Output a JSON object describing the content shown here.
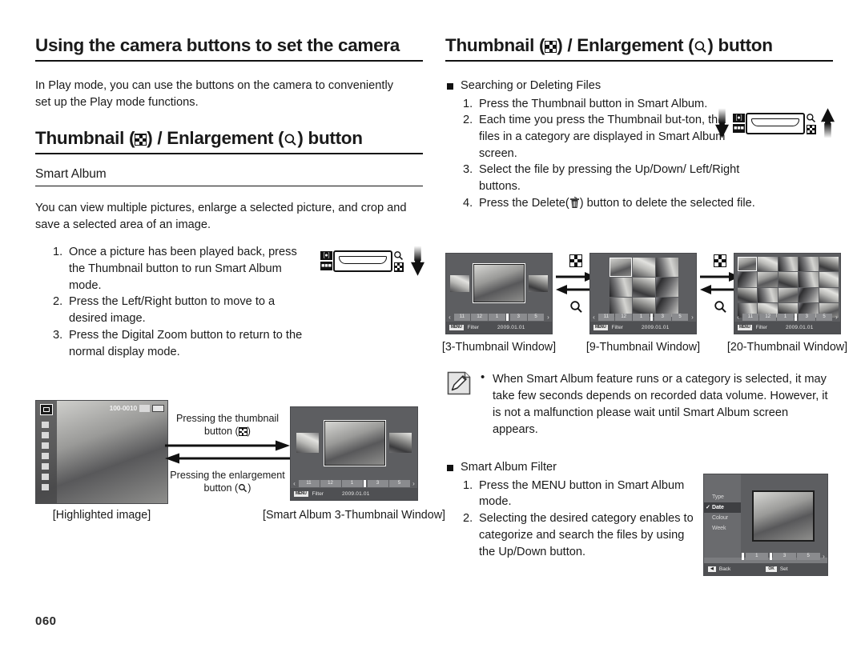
{
  "page": {
    "number": "060"
  },
  "left": {
    "title": "Using the camera buttons to set the camera",
    "intro": "In Play mode, you can use the buttons on the camera to conveniently set up the Play mode functions.",
    "section_title_pre": "Thumbnail (",
    "section_title_mid": ") / Enlargement (",
    "section_title_post": ") button",
    "subsection": "Smart Album",
    "body": "You can view multiple pictures, enlarge a selected picture, and crop and save a selected area of an image.",
    "steps": [
      {
        "num": "1.",
        "text": "Once a picture has been played back, press the Thumbnail button to run Smart Album mode."
      },
      {
        "num": "2.",
        "text": "Press the Left/Right button to move to a desired image."
      },
      {
        "num": "3.",
        "text": "Press the Digital Zoom button to return to the normal display mode."
      }
    ],
    "arrow_top_l1": "Pressing the thumbnail",
    "arrow_top_l2": "button (",
    "arrow_top_l3": ")",
    "arrow_bot_l1": "Pressing the enlargement",
    "arrow_bot_l2": "button (",
    "arrow_bot_l3": ")",
    "caption_highlighted": "[Highlighted image]",
    "caption_smartalbum3": "[Smart Album 3-Thumbnail Window]",
    "photo_osd": {
      "filenum": "100-0010"
    }
  },
  "right": {
    "title_pre": "Thumbnail (",
    "title_mid": ") / Enlargement (",
    "title_post": ") button",
    "searching_heading": "Searching or Deleting Files",
    "steps": [
      {
        "num": "1.",
        "text": "Press the Thumbnail button in Smart Album."
      },
      {
        "num": "2.",
        "text": "Each time you press the Thumbnail but-ton, the files in a category are displayed in Smart Album screen."
      },
      {
        "num": "3.",
        "text": "Select the file by pressing the Up/Down/ Left/Right buttons."
      },
      {
        "num": "4.",
        "text_pre": "Press the Delete(",
        "text_post": ") button to delete the selected file."
      }
    ],
    "captions": [
      "[3-Thumbnail Window]",
      "[9-Thumbnail Window]",
      "[20-Thumbnail Window]"
    ],
    "note": "When Smart Album feature runs or a category is selected, it may take few seconds depends on recorded data volume. However, it is not a malfunction please wait until Smart Album screen appears.",
    "filter_heading": "Smart Album Filter",
    "filter_steps": [
      {
        "num": "1.",
        "text": "Press the MENU button in Smart Album mode."
      },
      {
        "num": "2.",
        "text": "Selecting the desired category enables to categorize and search the files by using the Up/Down button."
      }
    ]
  },
  "lcd": {
    "nav_slots": [
      "11",
      "12",
      "1",
      "3",
      "5"
    ],
    "nav_selected": "1",
    "nav_left_arrow": "‹",
    "nav_right_arrow": "›",
    "menu_chip": "MENU",
    "filter_label": "Filter",
    "date": "2009.01.01"
  },
  "filter_menu": {
    "items": [
      "Type",
      "Date",
      "Colour",
      "Week"
    ],
    "selected": "Date",
    "back_chip": "◀",
    "back_label": "Back",
    "set_chip": "OK",
    "set_label": "Set",
    "nav_slots": [
      "1",
      "3",
      "5"
    ]
  },
  "icons": {
    "thumbnail": "thumbnail-grid-icon",
    "enlargement": "magnifier-icon",
    "delete": "trash-icon",
    "note": "pencil-note-icon"
  },
  "colors": {
    "text": "#1a1a1a",
    "rule": "#111111",
    "lcd_bg": "#6f7073",
    "lcd_bar": "#4f5053"
  }
}
